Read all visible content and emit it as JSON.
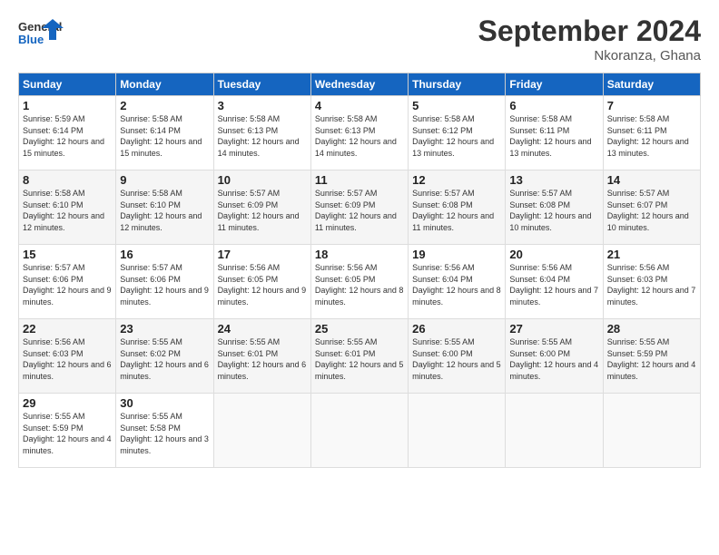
{
  "header": {
    "logo_general": "General",
    "logo_blue": "Blue",
    "month": "September 2024",
    "location": "Nkoranza, Ghana"
  },
  "days_of_week": [
    "Sunday",
    "Monday",
    "Tuesday",
    "Wednesday",
    "Thursday",
    "Friday",
    "Saturday"
  ],
  "weeks": [
    [
      {
        "day": "1",
        "sunrise": "Sunrise: 5:59 AM",
        "sunset": "Sunset: 6:14 PM",
        "daylight": "Daylight: 12 hours and 15 minutes."
      },
      {
        "day": "2",
        "sunrise": "Sunrise: 5:58 AM",
        "sunset": "Sunset: 6:14 PM",
        "daylight": "Daylight: 12 hours and 15 minutes."
      },
      {
        "day": "3",
        "sunrise": "Sunrise: 5:58 AM",
        "sunset": "Sunset: 6:13 PM",
        "daylight": "Daylight: 12 hours and 14 minutes."
      },
      {
        "day": "4",
        "sunrise": "Sunrise: 5:58 AM",
        "sunset": "Sunset: 6:13 PM",
        "daylight": "Daylight: 12 hours and 14 minutes."
      },
      {
        "day": "5",
        "sunrise": "Sunrise: 5:58 AM",
        "sunset": "Sunset: 6:12 PM",
        "daylight": "Daylight: 12 hours and 13 minutes."
      },
      {
        "day": "6",
        "sunrise": "Sunrise: 5:58 AM",
        "sunset": "Sunset: 6:11 PM",
        "daylight": "Daylight: 12 hours and 13 minutes."
      },
      {
        "day": "7",
        "sunrise": "Sunrise: 5:58 AM",
        "sunset": "Sunset: 6:11 PM",
        "daylight": "Daylight: 12 hours and 13 minutes."
      }
    ],
    [
      {
        "day": "8",
        "sunrise": "Sunrise: 5:58 AM",
        "sunset": "Sunset: 6:10 PM",
        "daylight": "Daylight: 12 hours and 12 minutes."
      },
      {
        "day": "9",
        "sunrise": "Sunrise: 5:58 AM",
        "sunset": "Sunset: 6:10 PM",
        "daylight": "Daylight: 12 hours and 12 minutes."
      },
      {
        "day": "10",
        "sunrise": "Sunrise: 5:57 AM",
        "sunset": "Sunset: 6:09 PM",
        "daylight": "Daylight: 12 hours and 11 minutes."
      },
      {
        "day": "11",
        "sunrise": "Sunrise: 5:57 AM",
        "sunset": "Sunset: 6:09 PM",
        "daylight": "Daylight: 12 hours and 11 minutes."
      },
      {
        "day": "12",
        "sunrise": "Sunrise: 5:57 AM",
        "sunset": "Sunset: 6:08 PM",
        "daylight": "Daylight: 12 hours and 11 minutes."
      },
      {
        "day": "13",
        "sunrise": "Sunrise: 5:57 AM",
        "sunset": "Sunset: 6:08 PM",
        "daylight": "Daylight: 12 hours and 10 minutes."
      },
      {
        "day": "14",
        "sunrise": "Sunrise: 5:57 AM",
        "sunset": "Sunset: 6:07 PM",
        "daylight": "Daylight: 12 hours and 10 minutes."
      }
    ],
    [
      {
        "day": "15",
        "sunrise": "Sunrise: 5:57 AM",
        "sunset": "Sunset: 6:06 PM",
        "daylight": "Daylight: 12 hours and 9 minutes."
      },
      {
        "day": "16",
        "sunrise": "Sunrise: 5:57 AM",
        "sunset": "Sunset: 6:06 PM",
        "daylight": "Daylight: 12 hours and 9 minutes."
      },
      {
        "day": "17",
        "sunrise": "Sunrise: 5:56 AM",
        "sunset": "Sunset: 6:05 PM",
        "daylight": "Daylight: 12 hours and 9 minutes."
      },
      {
        "day": "18",
        "sunrise": "Sunrise: 5:56 AM",
        "sunset": "Sunset: 6:05 PM",
        "daylight": "Daylight: 12 hours and 8 minutes."
      },
      {
        "day": "19",
        "sunrise": "Sunrise: 5:56 AM",
        "sunset": "Sunset: 6:04 PM",
        "daylight": "Daylight: 12 hours and 8 minutes."
      },
      {
        "day": "20",
        "sunrise": "Sunrise: 5:56 AM",
        "sunset": "Sunset: 6:04 PM",
        "daylight": "Daylight: 12 hours and 7 minutes."
      },
      {
        "day": "21",
        "sunrise": "Sunrise: 5:56 AM",
        "sunset": "Sunset: 6:03 PM",
        "daylight": "Daylight: 12 hours and 7 minutes."
      }
    ],
    [
      {
        "day": "22",
        "sunrise": "Sunrise: 5:56 AM",
        "sunset": "Sunset: 6:03 PM",
        "daylight": "Daylight: 12 hours and 6 minutes."
      },
      {
        "day": "23",
        "sunrise": "Sunrise: 5:55 AM",
        "sunset": "Sunset: 6:02 PM",
        "daylight": "Daylight: 12 hours and 6 minutes."
      },
      {
        "day": "24",
        "sunrise": "Sunrise: 5:55 AM",
        "sunset": "Sunset: 6:01 PM",
        "daylight": "Daylight: 12 hours and 6 minutes."
      },
      {
        "day": "25",
        "sunrise": "Sunrise: 5:55 AM",
        "sunset": "Sunset: 6:01 PM",
        "daylight": "Daylight: 12 hours and 5 minutes."
      },
      {
        "day": "26",
        "sunrise": "Sunrise: 5:55 AM",
        "sunset": "Sunset: 6:00 PM",
        "daylight": "Daylight: 12 hours and 5 minutes."
      },
      {
        "day": "27",
        "sunrise": "Sunrise: 5:55 AM",
        "sunset": "Sunset: 6:00 PM",
        "daylight": "Daylight: 12 hours and 4 minutes."
      },
      {
        "day": "28",
        "sunrise": "Sunrise: 5:55 AM",
        "sunset": "Sunset: 5:59 PM",
        "daylight": "Daylight: 12 hours and 4 minutes."
      }
    ],
    [
      {
        "day": "29",
        "sunrise": "Sunrise: 5:55 AM",
        "sunset": "Sunset: 5:59 PM",
        "daylight": "Daylight: 12 hours and 4 minutes."
      },
      {
        "day": "30",
        "sunrise": "Sunrise: 5:55 AM",
        "sunset": "Sunset: 5:58 PM",
        "daylight": "Daylight: 12 hours and 3 minutes."
      },
      null,
      null,
      null,
      null,
      null
    ]
  ]
}
